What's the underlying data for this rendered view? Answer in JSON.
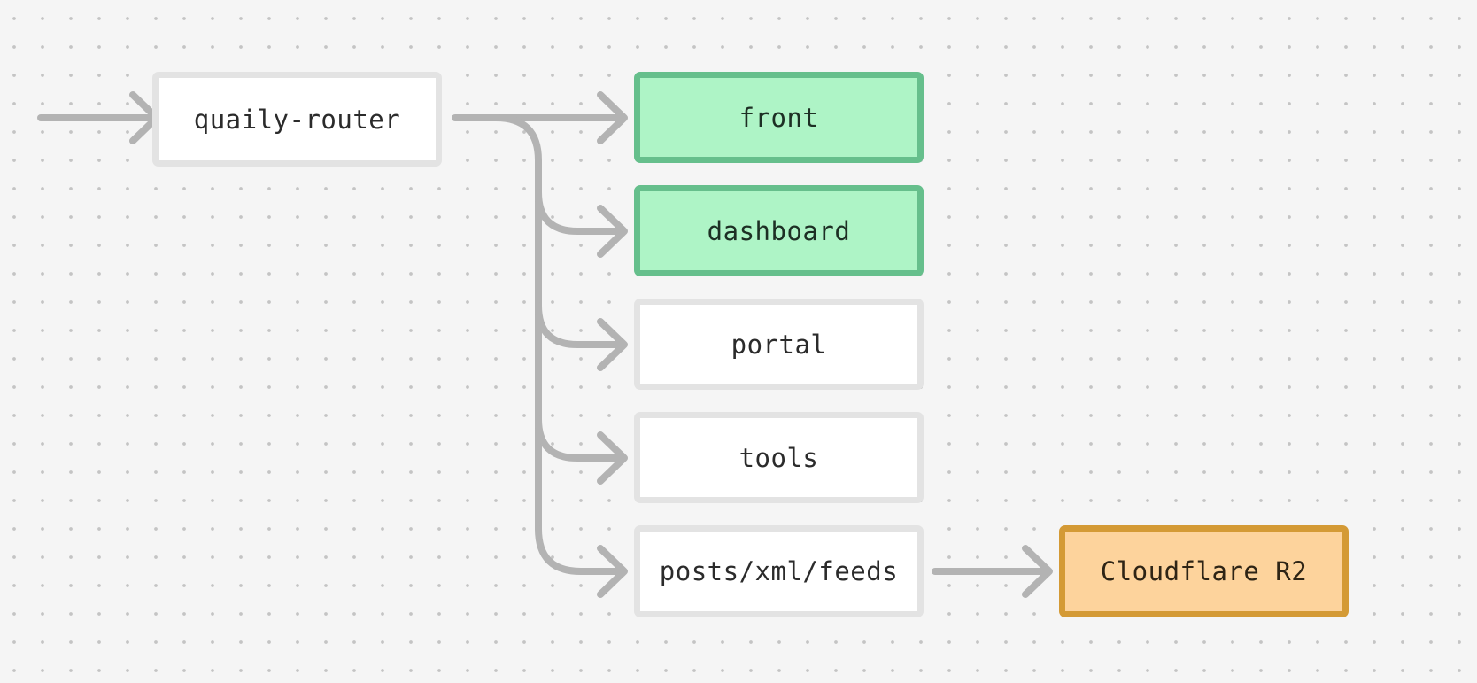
{
  "diagram": {
    "type": "flowchart",
    "nodes": [
      {
        "id": "router",
        "label": "quaily-router",
        "style": "default"
      },
      {
        "id": "front",
        "label": "front",
        "style": "highlight-green"
      },
      {
        "id": "dashboard",
        "label": "dashboard",
        "style": "highlight-green"
      },
      {
        "id": "portal",
        "label": "portal",
        "style": "default"
      },
      {
        "id": "tools",
        "label": "tools",
        "style": "default"
      },
      {
        "id": "posts",
        "label": "posts/xml/feeds",
        "style": "default"
      },
      {
        "id": "r2",
        "label": "Cloudflare R2",
        "style": "highlight-orange"
      }
    ],
    "edges": [
      {
        "from": "input",
        "to": "router"
      },
      {
        "from": "router",
        "to": "front"
      },
      {
        "from": "router",
        "to": "dashboard"
      },
      {
        "from": "router",
        "to": "portal"
      },
      {
        "from": "router",
        "to": "tools"
      },
      {
        "from": "router",
        "to": "posts"
      },
      {
        "from": "posts",
        "to": "r2"
      }
    ],
    "colors": {
      "background": "#f5f5f5",
      "edge": "#b3b3b3",
      "default_fill": "#ffffff",
      "default_border": "#e3e3e3",
      "green_fill": "#aef4c6",
      "green_border": "#66bf8c",
      "orange_fill": "#fdd39c",
      "orange_border": "#d49a35"
    }
  }
}
